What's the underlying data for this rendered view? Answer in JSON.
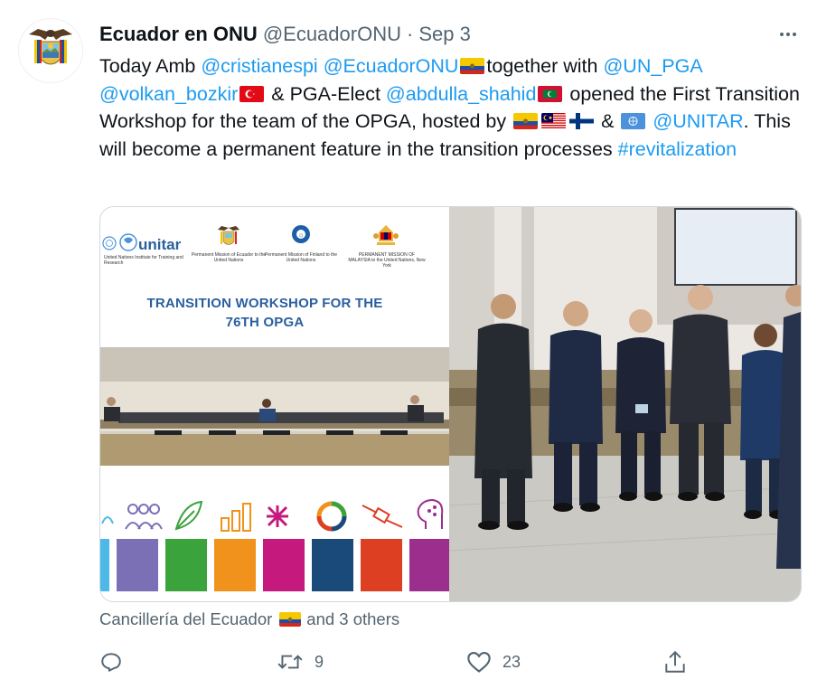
{
  "author": {
    "display_name": "Ecuador en ONU",
    "handle": "@EcuadorONU",
    "separator": "·",
    "date": "Sep 3",
    "avatar_icon": "ecuador-coat-of-arms"
  },
  "tweet": {
    "t1": "Today Amb ",
    "m1": "@cristianespi",
    "s1": " ",
    "m2": "@EcuadorONU",
    "t2": "together with ",
    "m3": "@UN_PGA",
    "m4": "@volkan_bozkir",
    "t3": " & PGA-Elect ",
    "m5": "@abdulla_shahid",
    "t4": " opened the First Transition Workshop for the team of the OPGA, hosted by ",
    "t5": " & ",
    "m6": "@UNITAR",
    "t6": ". This will become a permanent feature in the transition processes ",
    "h1": "#revitalization",
    "link_color": "#1d9bf0"
  },
  "media": {
    "poster": {
      "unitar_logo": "unitar",
      "unitar_caption": "United Nations Institute for Training and Research",
      "ecuador_caption": "Permanent Mission of Ecuador to the United Nations",
      "finland_caption": "Permanent Mission of Finland to the United Nations",
      "malaysia_caption": "PERMANENT MISSION OF MALAYSIA to the United Nations, New York",
      "title_line1": "TRANSITION WORKSHOP FOR THE",
      "title_line2": "76TH OPGA",
      "sdg_colors": [
        "#4cb9e7",
        "#7b6fb6",
        "#3ba33c",
        "#f0921b",
        "#c5197d",
        "#1a4a7a",
        "#dd3f23",
        "#9c2f8e"
      ]
    }
  },
  "social_context": {
    "name": "Cancillería del Ecuador",
    "suffix": "and 3 others"
  },
  "actions": {
    "retweet_count": "9",
    "like_count": "23"
  }
}
